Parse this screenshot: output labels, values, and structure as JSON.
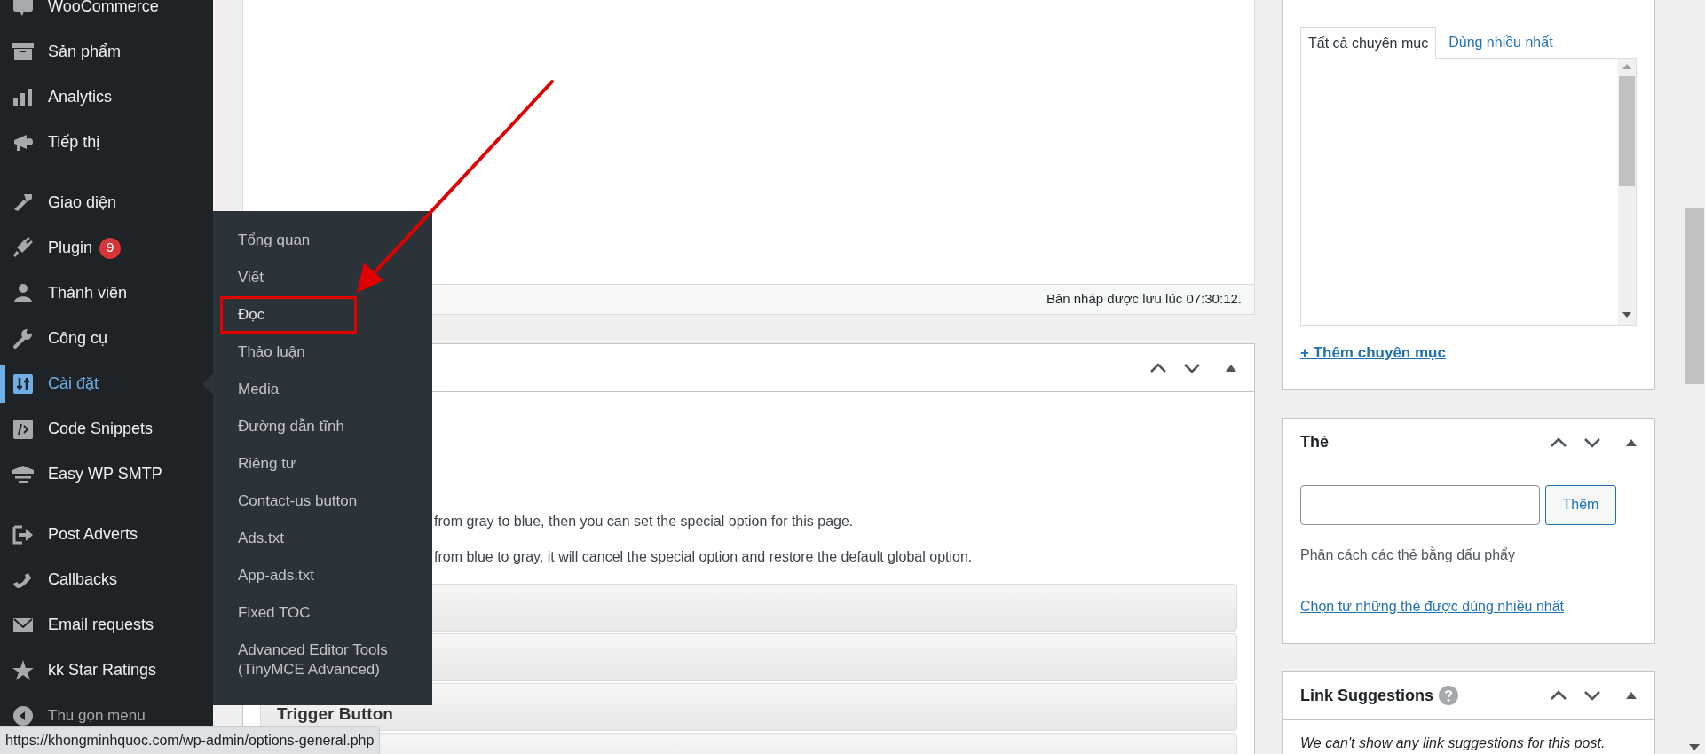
{
  "sidebar": {
    "groups": [
      [
        {
          "label": "WooCommerce",
          "selected": false
        },
        {
          "label": "Sản phẩm",
          "selected": false
        },
        {
          "label": "Analytics",
          "selected": false
        },
        {
          "label": "Tiếp thị",
          "selected": false
        }
      ],
      [
        {
          "label": "Giao diện",
          "selected": false
        },
        {
          "label": "Plugin",
          "badge": "9",
          "selected": false
        },
        {
          "label": "Thành viên",
          "selected": false
        },
        {
          "label": "Công cụ",
          "selected": false
        },
        {
          "label": "Cài đặt",
          "selected": true
        },
        {
          "label": "Code Snippets",
          "selected": false
        },
        {
          "label": "Easy WP SMTP",
          "selected": false
        }
      ],
      [
        {
          "label": "Post Adverts",
          "selected": false
        },
        {
          "label": "Callbacks",
          "selected": false
        },
        {
          "label": "Email requests",
          "selected": false
        },
        {
          "label": "kk Star Ratings",
          "selected": false
        }
      ]
    ],
    "collapse_label": "Thu gọn menu"
  },
  "submenu": {
    "items": [
      {
        "label": "Tổng quan",
        "highlighted": false
      },
      {
        "label": "Viết",
        "highlighted": false
      },
      {
        "label": "Đọc",
        "highlighted": true
      },
      {
        "label": "Thảo luận",
        "highlighted": false
      },
      {
        "label": "Media",
        "highlighted": false
      },
      {
        "label": "Đường dẫn tĩnh",
        "highlighted": false
      },
      {
        "label": "Riêng tư",
        "highlighted": false
      },
      {
        "label": "Contact-us button",
        "highlighted": false
      },
      {
        "label": "Ads.txt",
        "highlighted": false
      },
      {
        "label": "App-ads.txt",
        "highlighted": false
      },
      {
        "label": "Fixed TOC",
        "highlighted": false
      },
      {
        "label": "Advanced Editor Tools (TinyMCE Advanced)",
        "highlighted": false
      }
    ]
  },
  "editor": {
    "draft_status": "Bản nháp được lưu lúc 07:30:12."
  },
  "options_box": {
    "lines": [
      "from gray to blue, then you can set the special option for this page.",
      "from blue to gray, it will cancel the special option and restore the default global option."
    ],
    "rows": [
      {
        "kind": "bar"
      },
      {
        "kind": "bar"
      },
      {
        "kind": "bar",
        "label": "Trigger Button"
      },
      {
        "kind": "bar"
      }
    ]
  },
  "categories": {
    "tabs": [
      {
        "label": "Tất cả chuyên mục",
        "selected": true
      },
      {
        "label": "Dùng nhiều nhất",
        "selected": false
      }
    ],
    "add_link": "+ Thêm chuyên mục"
  },
  "tags": {
    "title": "Thẻ",
    "button": "Thêm",
    "hint": "Phân cách các thẻ bằng dấu phẩy",
    "link": "Chọn từ những thẻ được dùng nhiều nhất"
  },
  "link_suggestions": {
    "title": "Link Suggestions",
    "message": "We can't show any link suggestions for this post."
  },
  "status_bar": {
    "url": "https://khongminhquoc.com/wp-admin/options-general.php"
  }
}
